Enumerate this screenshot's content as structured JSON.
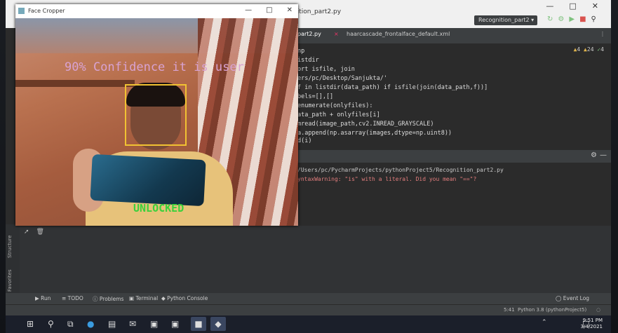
{
  "ide": {
    "file_title": "nition_part2.py",
    "run_config": "Recognition_part2",
    "tabs": [
      "part2.py",
      "haarcascade_frontalface_default.xml"
    ],
    "inspections": {
      "warnings": "4",
      "weak": "24",
      "ok": "4"
    },
    "code_lines": [
      "np",
      "istdir",
      "ort isfile, join",
      "ers/pc/Desktop/Sanjukta/'",
      "f in listdir(data_path) if isfile(join(data_path,f))]",
      "bels=[],[]",
      "enumerate(onlyfiles):",
      "ata_path + onlyfiles[i]",
      "mread(image_path,cv2.INREAD_GRAYSCALE)",
      "a.append(np.asarray(images,dtype=np.uint8))",
      "d(i)"
    ],
    "console_output": "/Users/pc/PycharmProjects/pythonProject5/Recognition_part2.py",
    "console_warning": "yntaxWarning: \"is\" with a literal. Did you mean \"==\"?",
    "side_labels": [
      "Structure",
      "Favorites"
    ],
    "toolbar": [
      "Run",
      "TODO",
      "Problems",
      "Terminal",
      "Python Console"
    ],
    "event_log": "Event Log",
    "status_pos": "5:41",
    "status_interp": "Python 3.8 (pythonProject5)"
  },
  "cropper": {
    "title": "Face Cropper",
    "confidence_text": "90% Confidence it is user",
    "status_text": "UNLOCKED"
  },
  "taskbar": {
    "time": "9:51 PM",
    "date": "3/4/2021"
  }
}
